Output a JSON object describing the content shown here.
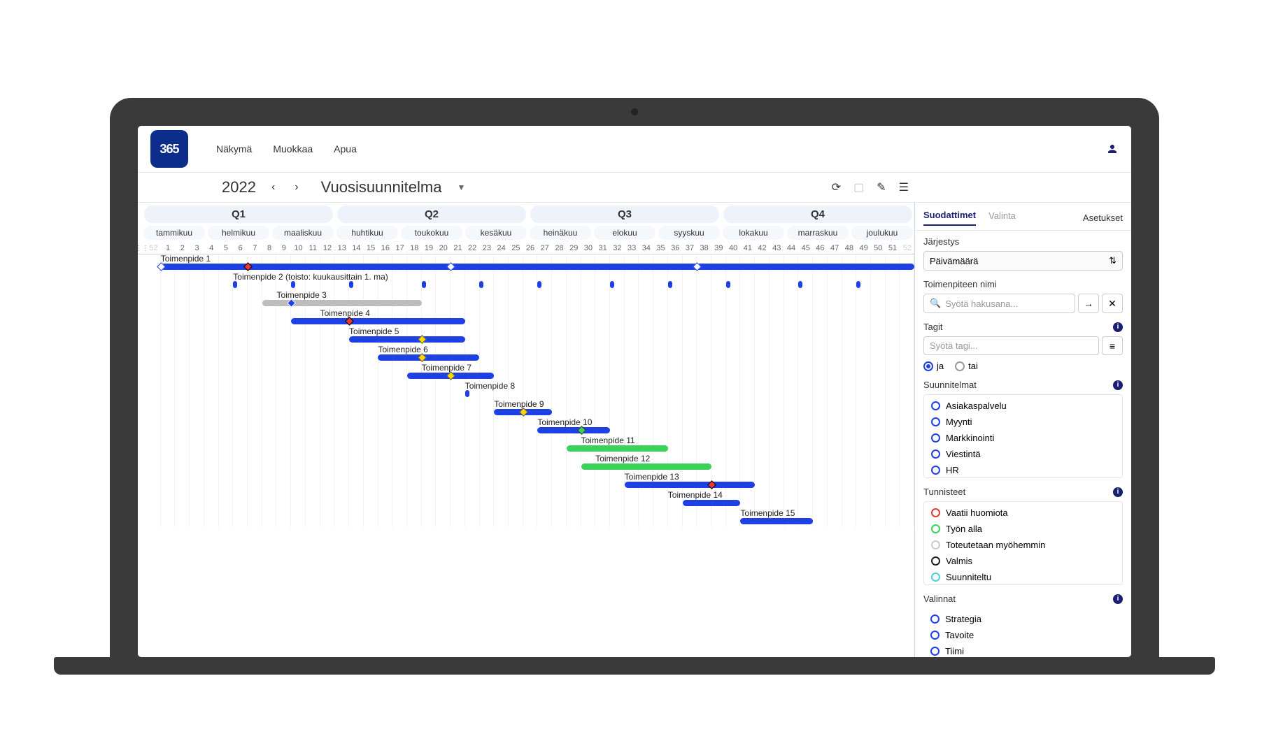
{
  "logo_text": "365",
  "menu": [
    "Näkymä",
    "Muokkaa",
    "Apua"
  ],
  "year": "2022",
  "plan_title": "Vuosisuunnitelma",
  "quarters": [
    "Q1",
    "Q2",
    "Q3",
    "Q4"
  ],
  "months": [
    "tammikuu",
    "helmikuu",
    "maaliskuu",
    "huhtikuu",
    "toukokuu",
    "kesäkuu",
    "heinäkuu",
    "elokuu",
    "syyskuu",
    "lokakuu",
    "marraskuu",
    "joulukuu"
  ],
  "weeks": [
    "52",
    "1",
    "2",
    "3",
    "4",
    "5",
    "6",
    "7",
    "8",
    "9",
    "10",
    "11",
    "12",
    "13",
    "14",
    "15",
    "16",
    "17",
    "18",
    "19",
    "20",
    "21",
    "22",
    "23",
    "24",
    "25",
    "26",
    "27",
    "28",
    "29",
    "30",
    "31",
    "32",
    "33",
    "34",
    "35",
    "36",
    "37",
    "38",
    "39",
    "40",
    "41",
    "42",
    "43",
    "44",
    "45",
    "46",
    "47",
    "48",
    "49",
    "50",
    "51",
    "52"
  ],
  "tasks": [
    {
      "label": "Toimenpide 1",
      "start": 1,
      "end": 53,
      "color": "blue",
      "label_at": 1,
      "markers": [
        {
          "at": 1,
          "type": "white"
        },
        {
          "at": 7,
          "type": "red"
        },
        {
          "at": 21,
          "type": "white"
        },
        {
          "at": 38,
          "type": "white"
        }
      ]
    },
    {
      "label": "Toimenpide 2 (toisto: kuukausittain 1. ma)",
      "ticks": [
        6,
        10,
        14,
        19,
        23,
        27,
        32,
        36,
        40,
        45,
        49
      ],
      "label_at": 6
    },
    {
      "label": "Toimenpide 3",
      "start": 8,
      "end": 19,
      "color": "gray",
      "label_at": 9,
      "markers": [
        {
          "at": 10,
          "type": "blue"
        }
      ]
    },
    {
      "label": "Toimenpide 4",
      "start": 10,
      "end": 22,
      "color": "blue",
      "label_at": 12,
      "markers": [
        {
          "at": 14,
          "type": "red"
        }
      ]
    },
    {
      "label": "Toimenpide 5",
      "start": 14,
      "end": 22,
      "color": "blue",
      "label_at": 14,
      "markers": [
        {
          "at": 19,
          "type": "yellow"
        }
      ]
    },
    {
      "label": "Toimenpide 6",
      "start": 16,
      "end": 23,
      "color": "blue",
      "label_at": 16,
      "markers": [
        {
          "at": 19,
          "type": "yellow"
        }
      ]
    },
    {
      "label": "Toimenpide 7",
      "start": 18,
      "end": 24,
      "color": "blue",
      "label_at": 19,
      "markers": [
        {
          "at": 21,
          "type": "yellow"
        }
      ]
    },
    {
      "label": "Toimenpide 8",
      "ticks": [
        22
      ],
      "label_at": 22
    },
    {
      "label": "Toimenpide 9",
      "start": 24,
      "end": 28,
      "color": "blue",
      "label_at": 24,
      "markers": [
        {
          "at": 26,
          "type": "yellow"
        }
      ]
    },
    {
      "label": "Toimenpide 10",
      "start": 27,
      "end": 32,
      "color": "blue",
      "label_at": 27,
      "markers": [
        {
          "at": 30,
          "type": "green"
        }
      ]
    },
    {
      "label": "Toimenpide 11",
      "start": 29,
      "end": 36,
      "color": "green",
      "label_at": 30
    },
    {
      "label": "Toimenpide 12",
      "start": 30,
      "end": 39,
      "color": "green",
      "label_at": 31
    },
    {
      "label": "Toimenpide 13",
      "start": 33,
      "end": 42,
      "color": "blue",
      "label_at": 33,
      "markers": [
        {
          "at": 39,
          "type": "red"
        }
      ]
    },
    {
      "label": "Toimenpide 14",
      "start": 37,
      "end": 41,
      "color": "blue",
      "label_at": 36
    },
    {
      "label": "Toimenpide 15",
      "start": 41,
      "end": 46,
      "color": "blue",
      "label_at": 41
    }
  ],
  "sidebar": {
    "tabs": {
      "filters": "Suodattimet",
      "selection": "Valinta",
      "settings": "Asetukset"
    },
    "order_label": "Järjestys",
    "order_value": "Päivämäärä",
    "name_label": "Toimenpiteen nimi",
    "name_placeholder": "Syötä hakusana...",
    "tags_label": "Tagit",
    "tags_placeholder": "Syötä tagi...",
    "and_label": "ja",
    "or_label": "tai",
    "plans_label": "Suunnitelmat",
    "plans": [
      "Asiakaspalvelu",
      "Myynti",
      "Markkinointi",
      "Viestintä",
      "HR"
    ],
    "statuses_label": "Tunnisteet",
    "statuses": [
      {
        "label": "Vaatii huomiota",
        "color": "c-red"
      },
      {
        "label": "Työn alla",
        "color": "c-green"
      },
      {
        "label": "Toteutetaan myöhemmin",
        "color": "c-gray"
      },
      {
        "label": "Valmis",
        "color": "c-black"
      },
      {
        "label": "Suunniteltu",
        "color": "c-cyan"
      }
    ],
    "selections_label": "Valinnat",
    "selections": [
      "Strategia",
      "Tavoite",
      "Tiimi"
    ]
  },
  "chart_data": {
    "type": "gantt",
    "title": "Vuosisuunnitelma 2022",
    "x_axis": "week number (1-52)",
    "series": [
      {
        "name": "Toimenpide 1",
        "start_week": 1,
        "end_week": 52,
        "color": "blue"
      },
      {
        "name": "Toimenpide 2",
        "recurrence": "monthly first monday",
        "weeks": [
          5,
          9,
          13,
          18,
          22,
          26,
          31,
          35,
          39,
          44,
          48
        ]
      },
      {
        "name": "Toimenpide 3",
        "start_week": 7,
        "end_week": 18,
        "color": "gray"
      },
      {
        "name": "Toimenpide 4",
        "start_week": 9,
        "end_week": 21,
        "color": "blue"
      },
      {
        "name": "Toimenpide 5",
        "start_week": 13,
        "end_week": 21,
        "color": "blue"
      },
      {
        "name": "Toimenpide 6",
        "start_week": 15,
        "end_week": 22,
        "color": "blue"
      },
      {
        "name": "Toimenpide 7",
        "start_week": 17,
        "end_week": 23,
        "color": "blue"
      },
      {
        "name": "Toimenpide 8",
        "start_week": 21,
        "end_week": 21,
        "color": "blue"
      },
      {
        "name": "Toimenpide 9",
        "start_week": 23,
        "end_week": 27,
        "color": "blue"
      },
      {
        "name": "Toimenpide 10",
        "start_week": 26,
        "end_week": 31,
        "color": "blue"
      },
      {
        "name": "Toimenpide 11",
        "start_week": 28,
        "end_week": 35,
        "color": "green"
      },
      {
        "name": "Toimenpide 12",
        "start_week": 29,
        "end_week": 38,
        "color": "green"
      },
      {
        "name": "Toimenpide 13",
        "start_week": 32,
        "end_week": 41,
        "color": "blue"
      },
      {
        "name": "Toimenpide 14",
        "start_week": 36,
        "end_week": 40,
        "color": "blue"
      },
      {
        "name": "Toimenpide 15",
        "start_week": 40,
        "end_week": 45,
        "color": "blue"
      }
    ]
  }
}
